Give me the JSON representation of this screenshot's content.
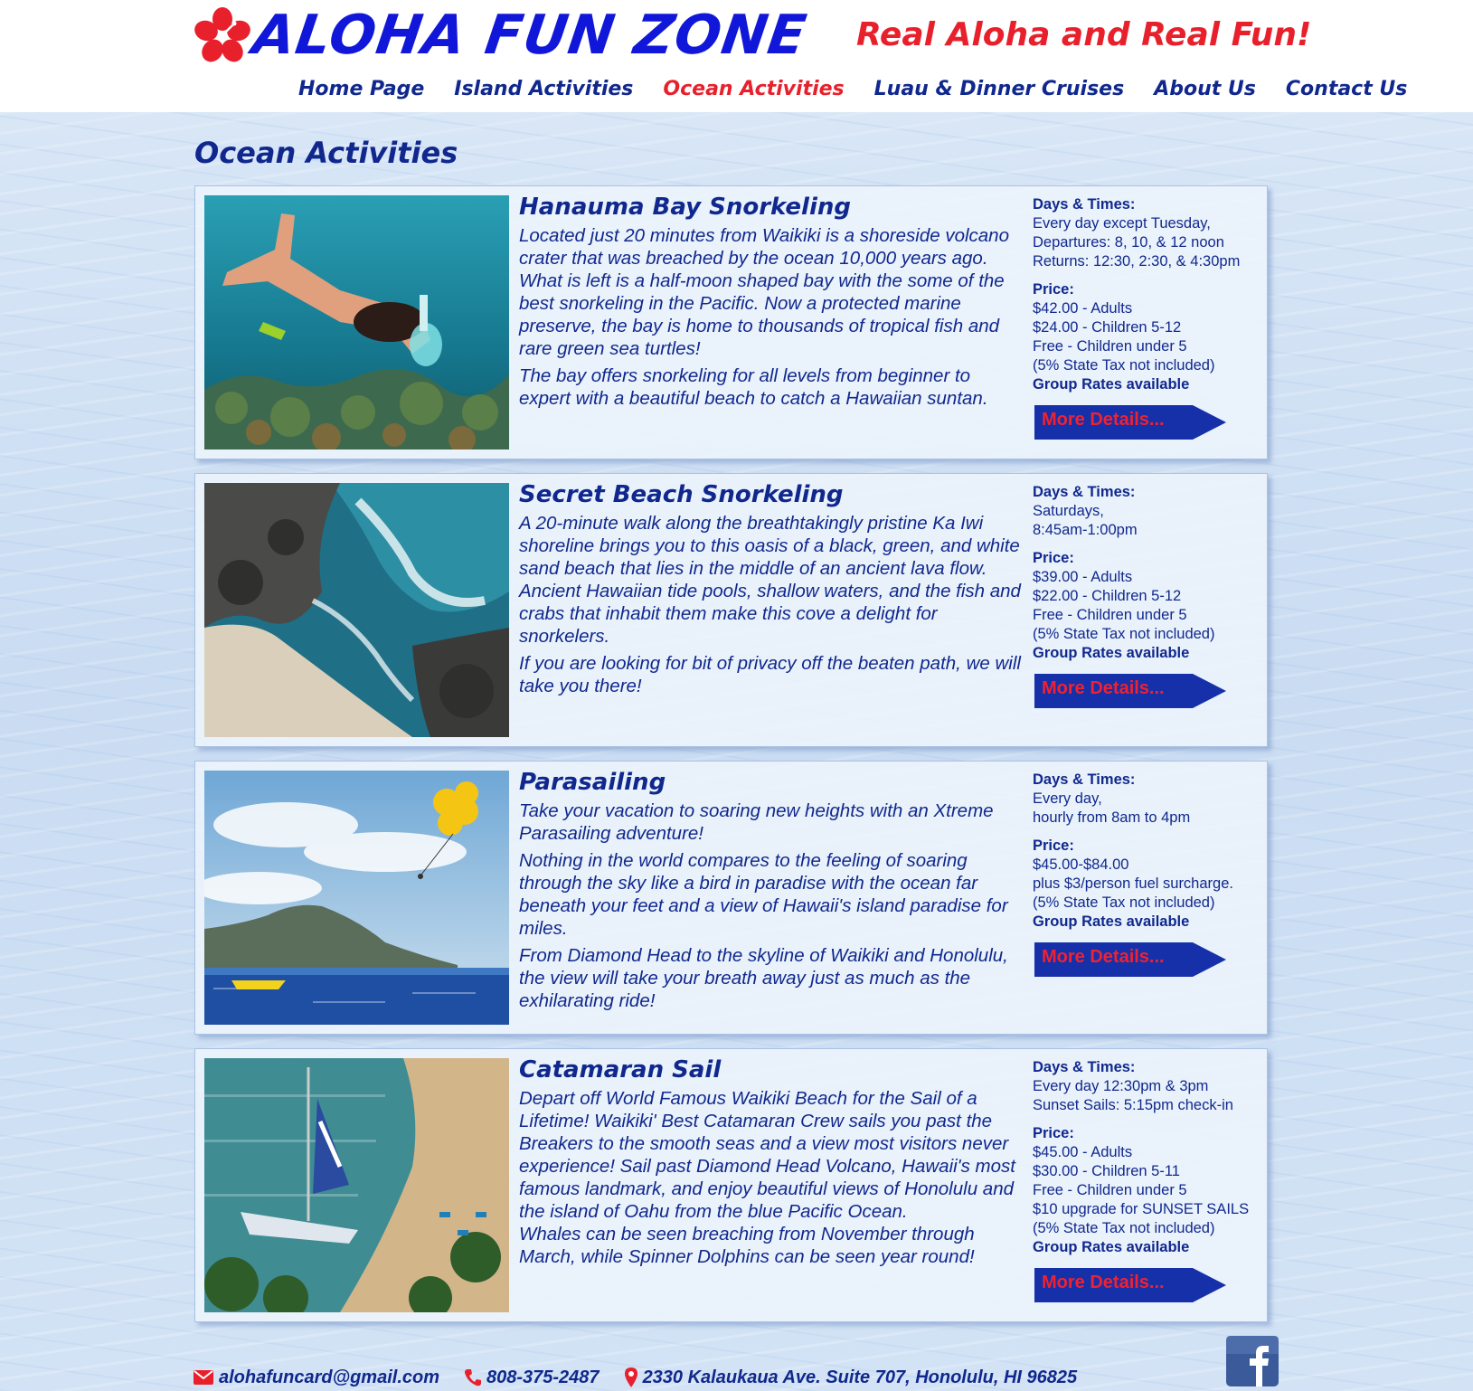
{
  "header": {
    "logo_text": "Aloha Fun Zone",
    "tagline": "Real Aloha and Real Fun!"
  },
  "nav": {
    "items": [
      {
        "label": "Home Page",
        "active": false
      },
      {
        "label": "Island Activities",
        "active": false
      },
      {
        "label": "Ocean Activities",
        "active": true
      },
      {
        "label": "Luau & Dinner Cruises",
        "active": false
      },
      {
        "label": "About Us",
        "active": false
      },
      {
        "label": "Contact Us",
        "active": false
      }
    ]
  },
  "page": {
    "title": "Ocean Activities"
  },
  "activities": [
    {
      "title": "Hanauma Bay Snorkeling",
      "paragraphs": [
        "Located just 20 minutes from Waikiki is a shoreside volcano crater that was breached by the ocean 10,000 years ago. What is left is a half-moon shaped bay with the some of the best snorkeling in the Pacific. Now a protected marine preserve, the bay is home to thousands of tropical fish and rare green sea turtles!",
        "The bay offers snorkeling for all levels from beginner to expert with a beautiful beach to catch a Hawaiian suntan."
      ],
      "days_label": "Days & Times:",
      "days_lines": [
        "Every day except Tuesday,",
        "Departures: 8, 10, & 12 noon",
        "Returns: 12:30, 2:30, & 4:30pm"
      ],
      "price_label": "Price:",
      "price_lines": [
        "$42.00 - Adults",
        "$24.00 - Children 5-12",
        "Free - Children under 5",
        "(5% State Tax not included)"
      ],
      "group_rates": "Group Rates available",
      "button": "More Details..."
    },
    {
      "title": "Secret Beach Snorkeling",
      "paragraphs": [
        "A 20-minute walk along the breathtakingly pristine Ka Iwi shoreline brings you to this oasis of a black, green, and white sand beach that lies in the middle of an ancient lava flow. Ancient Hawaiian tide pools, shallow waters, and the fish and crabs that inhabit them make this cove a delight for snorkelers.",
        "If you are looking for bit of privacy off the beaten path, we will take you there!"
      ],
      "days_label": "Days & Times:",
      "days_lines": [
        "Saturdays,",
        "8:45am-1:00pm"
      ],
      "price_label": "Price:",
      "price_lines": [
        "$39.00 - Adults",
        "$22.00 - Children 5-12",
        "Free - Children under 5",
        "(5% State Tax not included)"
      ],
      "group_rates": "Group Rates available",
      "button": "More Details..."
    },
    {
      "title": "Parasailing",
      "paragraphs": [
        "Take your vacation to soaring new heights with an Xtreme Parasailing adventure!",
        "Nothing in the world compares to the feeling of soaring through the sky like a bird in paradise with the ocean far beneath your feet and a view of Hawaii's island paradise for miles.",
        "From Diamond Head to the skyline of Waikiki and Honolulu, the view will take your breath away just as much as the exhilarating ride!"
      ],
      "days_label": "Days & Times:",
      "days_lines": [
        "Every day,",
        "hourly from 8am to 4pm"
      ],
      "price_label": "Price:",
      "price_lines": [
        "$45.00-$84.00",
        "plus $3/person fuel surcharge.",
        "(5% State Tax not included)"
      ],
      "group_rates": "Group Rates available",
      "button": "More Details..."
    },
    {
      "title": "Catamaran Sail",
      "paragraphs": [
        "Depart off World Famous Waikiki Beach for the Sail of a Lifetime! Waikiki' Best Catamaran Crew sails you past the Breakers to the smooth seas and a view most visitors never experience! Sail past Diamond Head Volcano, Hawaii's most famous landmark, and enjoy beautiful views of Honolulu and the island of Oahu from the blue Pacific Ocean.",
        "Whales can be seen breaching from November through March, while Spinner Dolphins can be seen year round!"
      ],
      "days_label": "Days & Times:",
      "days_lines": [
        "Every day 12:30pm & 3pm",
        "Sunset Sails: 5:15pm check-in"
      ],
      "price_label": "Price:",
      "price_lines": [
        "$45.00 - Adults",
        "$30.00 - Children 5-11",
        "Free - Children under 5",
        "$10 upgrade for SUNSET SAILS",
        "(5% State Tax not included)"
      ],
      "group_rates": "Group Rates available",
      "button": "More Details..."
    }
  ],
  "footer": {
    "email": "alohafuncard@gmail.com",
    "phone": "808-375-2487",
    "address": "2330 Kalaukaua Ave. Suite 707, Honolulu, HI 96825"
  },
  "colors": {
    "brand_blue": "#1117d8",
    "nav_blue": "#10288e",
    "accent_red": "#e8202c",
    "button_blue": "#1530a8",
    "background": "#cfe0f4"
  },
  "icons": [
    "hibiscus-icon",
    "envelope-icon",
    "phone-icon",
    "map-pin-icon",
    "facebook-icon",
    "arrow-button-shape"
  ]
}
